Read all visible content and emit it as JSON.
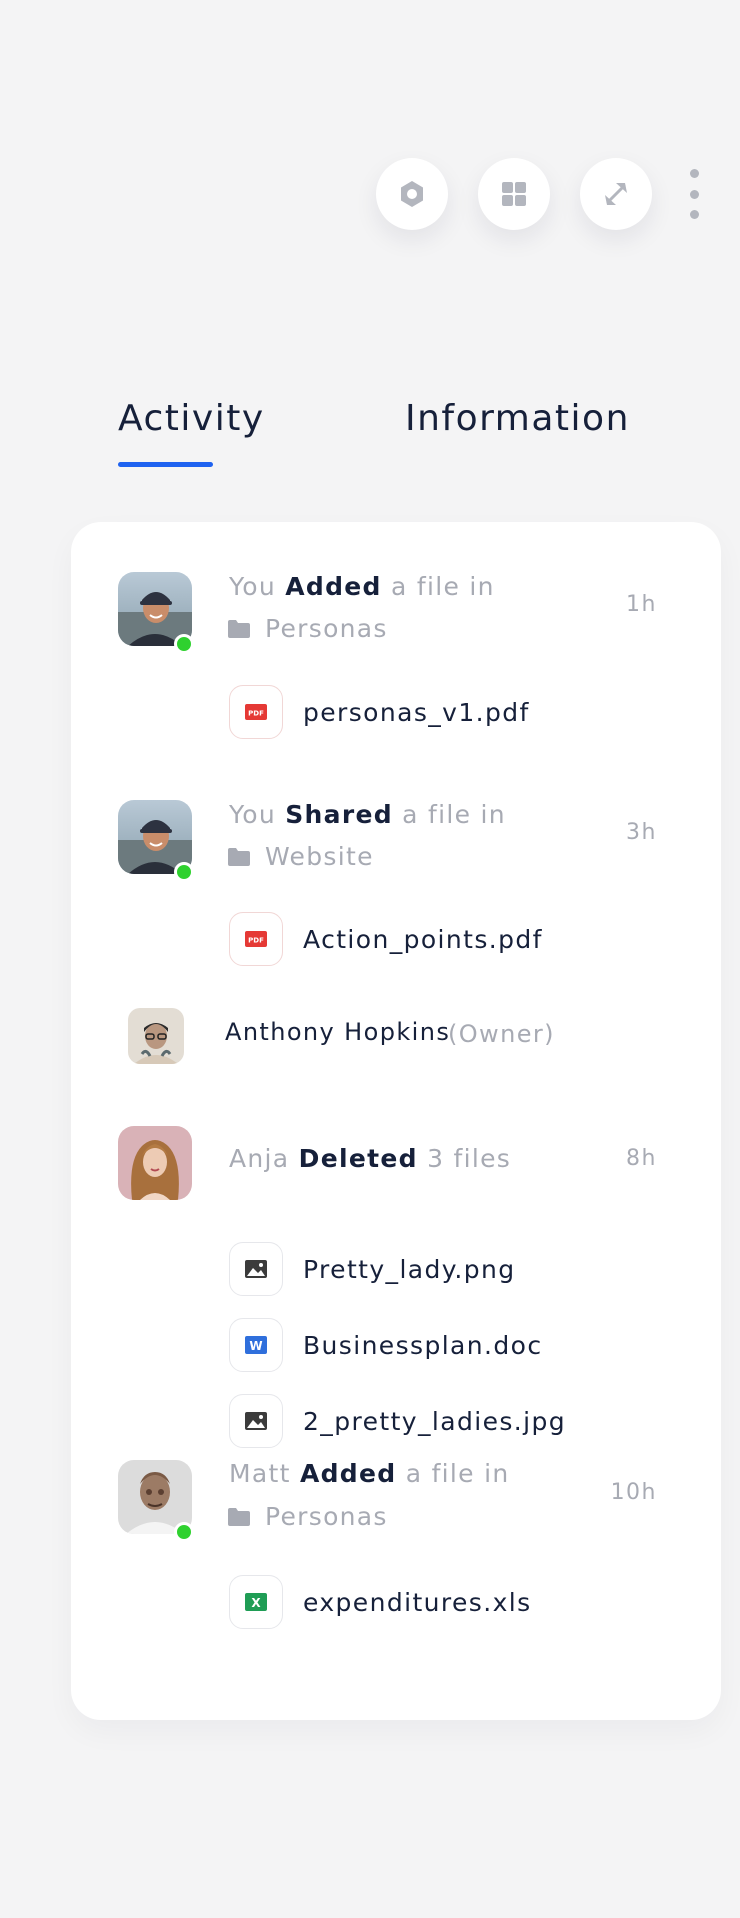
{
  "toolbar": {
    "buttons": [
      {
        "icon": "hexagon-settings-icon"
      },
      {
        "icon": "grid-icon"
      },
      {
        "icon": "expand-icon"
      }
    ],
    "menu_icon": "more-vertical-icon"
  },
  "tabs": [
    {
      "label": "Activity",
      "active": true
    },
    {
      "label": "Information",
      "active": false
    }
  ],
  "accent_color": "#1e62f0",
  "online_color": "#2fd12f",
  "activity": [
    {
      "actor": "You",
      "action": "Added",
      "rest": "a file in",
      "folder": "Personas",
      "time": "1h",
      "files": [
        {
          "name": "personas_v1.pdf",
          "type": "pdf"
        }
      ]
    },
    {
      "actor": "You",
      "action": "Shared",
      "rest": "a file in",
      "folder": "Website",
      "time": "3h",
      "files": [
        {
          "name": "Action_points.pdf",
          "type": "pdf"
        }
      ]
    },
    {
      "owner": {
        "name": "Anthony Hopkins",
        "role": "(Owner)"
      }
    },
    {
      "actor": "Anja",
      "action": "Deleted",
      "rest": "3 files",
      "time": "8h",
      "files": [
        {
          "name": "Pretty_lady.png",
          "type": "image"
        },
        {
          "name": "Businessplan.doc",
          "type": "doc"
        },
        {
          "name": "2_pretty_ladies.jpg",
          "type": "image"
        }
      ]
    },
    {
      "actor": "Matt",
      "action": "Added",
      "rest": "a file in",
      "folder": "Personas",
      "time": "10h",
      "files": [
        {
          "name": "expenditures.xls",
          "type": "xls"
        }
      ]
    }
  ]
}
